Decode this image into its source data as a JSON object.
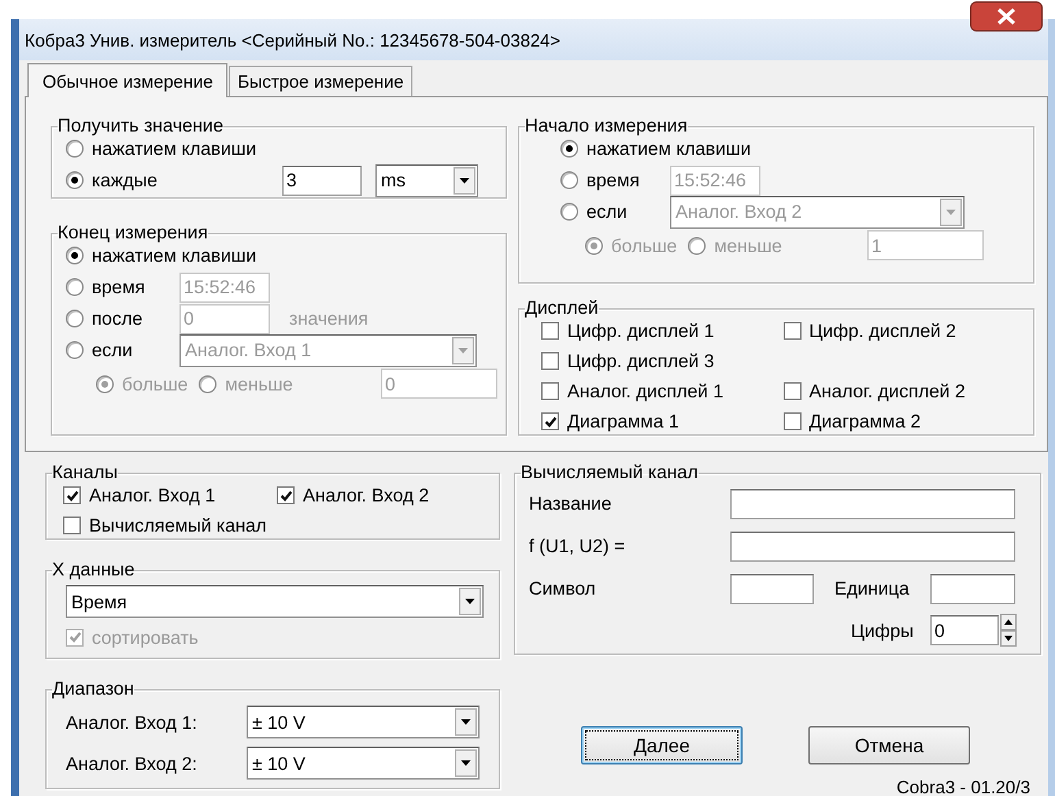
{
  "window": {
    "title": "Кобра3 Унив. измеритель  <Серийный No.: 12345678-504-03824>"
  },
  "tabs": [
    {
      "label": "Обычное измерение",
      "selected": true
    },
    {
      "label": "Быстрое измерение",
      "selected": false
    }
  ],
  "get_value": {
    "title": "Получить значение",
    "options": [
      {
        "kind": "plain",
        "label": "нажатием клавиши",
        "selected": false
      },
      {
        "kind": "interval",
        "label": "каждые",
        "selected": true,
        "value": "3",
        "unit": "ms"
      }
    ]
  },
  "end": {
    "title": "Конец измерения",
    "options": [
      {
        "kind": "plain",
        "label": "нажатием клавиши",
        "selected": true
      },
      {
        "kind": "time",
        "label": "время",
        "selected": false,
        "value": "15:52:46",
        "disabled": true
      },
      {
        "kind": "count",
        "label": "после",
        "selected": false,
        "value": "0",
        "suffix": "значения",
        "disabled": true
      },
      {
        "kind": "condition",
        "label": "если",
        "selected": false,
        "value": "Аналог. Вход 1",
        "disabled": true
      }
    ],
    "compare": {
      "disabled": true,
      "options": [
        {
          "label": "больше",
          "selected": true
        },
        {
          "label": "меньше",
          "selected": false
        }
      ],
      "threshold": "0"
    }
  },
  "start": {
    "title": "Начало измерения",
    "options": [
      {
        "kind": "plain",
        "label": "нажатием клавиши",
        "selected": true
      },
      {
        "kind": "time",
        "label": "время",
        "selected": false,
        "value": "15:52:46",
        "disabled": true
      },
      {
        "kind": "condition",
        "label": "если",
        "selected": false,
        "value": "Аналог. Вход 2",
        "disabled": true
      }
    ],
    "compare": {
      "disabled": true,
      "options": [
        {
          "label": "больше",
          "selected": true
        },
        {
          "label": "меньше",
          "selected": false
        }
      ],
      "threshold": "1"
    }
  },
  "display": {
    "title": "Дисплей",
    "rows": [
      [
        {
          "label": "Цифр. дисплей 1",
          "checked": false
        },
        {
          "label": "Цифр. дисплей 2",
          "checked": false
        }
      ],
      [
        {
          "label": "Цифр. дисплей 3",
          "checked": false
        }
      ],
      [
        {
          "label": "Аналог. дисплей 1",
          "checked": false
        },
        {
          "label": "Аналог. дисплей 2",
          "checked": false
        }
      ],
      [
        {
          "label": "Диаграмма 1",
          "checked": true
        },
        {
          "label": "Диаграмма 2",
          "checked": false
        }
      ]
    ]
  },
  "channels": {
    "title": "Каналы",
    "rows": [
      [
        {
          "label": "Аналог. Вход 1",
          "checked": true
        },
        {
          "label": "Аналог. Вход 2",
          "checked": true
        }
      ],
      [
        {
          "label": "Вычисляемый канал",
          "checked": false
        }
      ]
    ]
  },
  "x_data": {
    "title": "X данные",
    "value": "Время",
    "sort": {
      "label": "сортировать",
      "checked": true,
      "disabled": true
    }
  },
  "range": {
    "title": "Диапазон",
    "rows": [
      {
        "label": "Аналог. Вход 1:",
        "value": "± 10 V"
      },
      {
        "label": "Аналог. Вход 2:",
        "value": "± 10 V"
      }
    ]
  },
  "calc": {
    "title": "Вычисляемый канал",
    "name_label": "Название",
    "formula_label": "f (U1, U2) =",
    "symbol_label": "Символ",
    "unit_label": "Единица",
    "digits_label": "Цифры",
    "digits_value": "0"
  },
  "buttons": [
    {
      "label": "Далее",
      "focused": true
    },
    {
      "label": "Отмена",
      "focused": false
    }
  ],
  "version": "Cobra3 - 01.20/3"
}
